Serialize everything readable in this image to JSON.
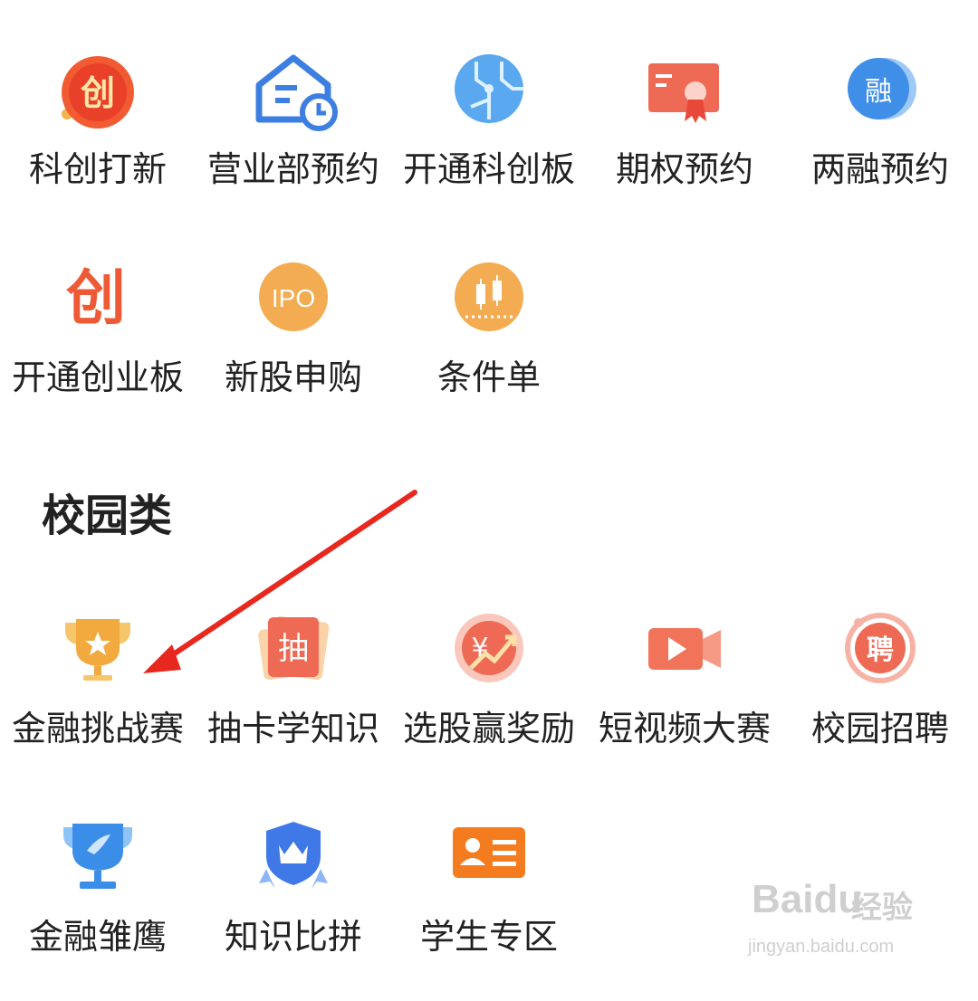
{
  "top_grid": {
    "items": [
      {
        "label": "科创打新",
        "icon_text": "创",
        "icon": "kechuang-icon"
      },
      {
        "label": "营业部预约",
        "icon": "branch-house-clock-icon"
      },
      {
        "label": "开通科创板",
        "icon": "circuit-icon"
      },
      {
        "label": "期权预约",
        "icon": "certificate-icon"
      },
      {
        "label": "两融预约",
        "icon_text": "融",
        "icon": "margin-coin-icon"
      },
      {
        "label": "开通创业板",
        "icon_text": "创",
        "icon": "chuangye-icon"
      },
      {
        "label": "新股申购",
        "icon_text": "IPO",
        "icon": "ipo-icon"
      },
      {
        "label": "条件单",
        "icon": "candlestick-icon"
      }
    ]
  },
  "campus": {
    "title": "校园类",
    "items": [
      {
        "label": "金融挑战赛",
        "icon": "trophy-star-icon"
      },
      {
        "label": "抽卡学知识",
        "icon_text": "抽",
        "icon": "draw-card-icon"
      },
      {
        "label": "选股赢奖励",
        "icon_text": "¥",
        "icon": "stock-reward-icon"
      },
      {
        "label": "短视频大赛",
        "icon": "video-camera-icon"
      },
      {
        "label": "校园招聘",
        "icon_text": "聘",
        "icon": "recruit-icon"
      },
      {
        "label": "金融雏鹰",
        "icon": "blue-trophy-icon"
      },
      {
        "label": "知识比拼",
        "icon": "crown-shield-icon"
      },
      {
        "label": "学生专区",
        "icon": "student-card-icon"
      }
    ]
  },
  "watermark": {
    "brand": "Baidu",
    "brand_cn": "经验",
    "url": "jingyan.baidu.com"
  },
  "colors": {
    "orange": "#f5a34a",
    "red": "#e8483a",
    "blue": "#3f86e8",
    "salmon": "#f27760"
  }
}
